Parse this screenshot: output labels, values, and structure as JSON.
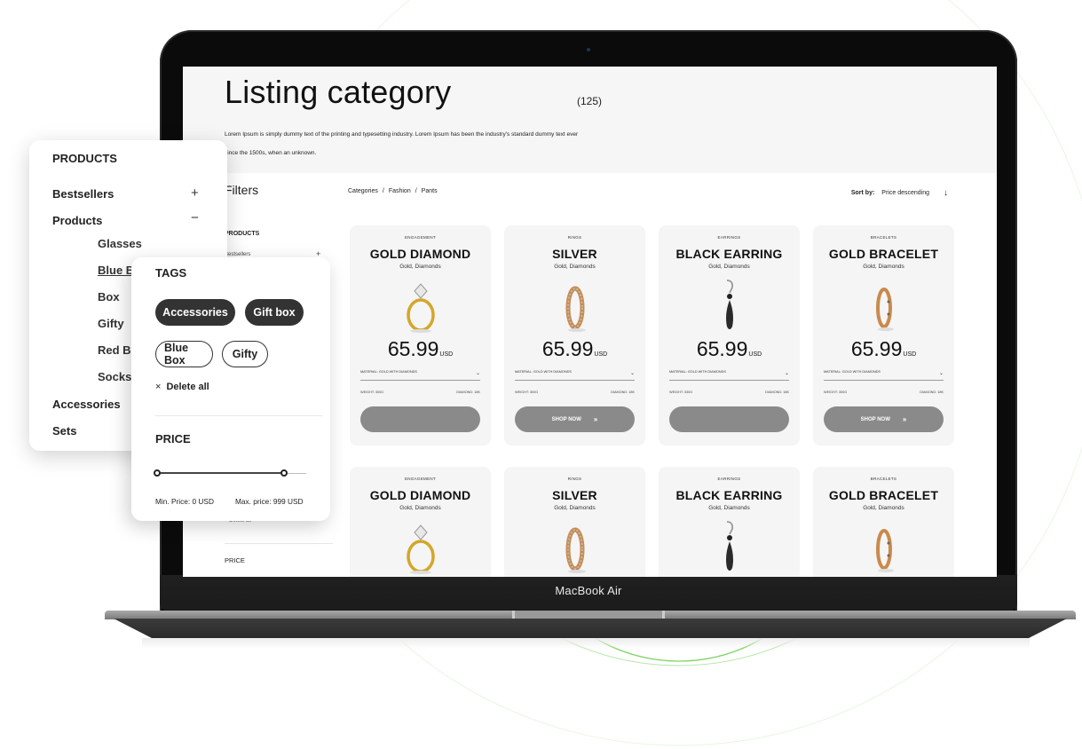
{
  "device": {
    "label": "MacBook Air"
  },
  "hero": {
    "title": "Listing category",
    "count": "(125)",
    "description": "Lorem Ipsum is simply dummy text of the printing and typesetting industry. Lorem Ipsum has been the industry's standard dummy text ever since the 1500s, when an unknown."
  },
  "filters": {
    "title": "Filters",
    "products_heading": "PRODUCTS",
    "bestsellers": "Bestsellers",
    "plus": "+",
    "delete_all": "× Delete all",
    "price_heading": "PRICE"
  },
  "breadcrumb": {
    "items": [
      "Categories",
      "Fashion",
      "Pants"
    ],
    "separator": "/"
  },
  "sort": {
    "label": "Sort by:",
    "value": "Price descending",
    "arrow": "↓"
  },
  "products": [
    {
      "category": "ENGAGEMENT",
      "name": "GOLD DIAMOND",
      "subtitle": "Gold, Diamonds",
      "price": "65.99",
      "currency": "USD",
      "material": "MATERIAL: GOLD WITH DIAMONDS",
      "weight": "WEIGHT: 300G",
      "diamond": "DIAMOND: 18K",
      "button": "",
      "image": "engagement-ring"
    },
    {
      "category": "RINGS",
      "name": "SILVER",
      "subtitle": "Gold, Diamonds",
      "price": "65.99",
      "currency": "USD",
      "material": "MATERIAL: GOLD WITH DIAMONDS",
      "weight": "WEIGHT: 300G",
      "diamond": "DIAMOND: 18K",
      "button": "SHOP NOW",
      "image": "eternity-ring"
    },
    {
      "category": "EARRINGS",
      "name": "BLACK EARRING",
      "subtitle": "Gold, Diamonds",
      "price": "65.99",
      "currency": "USD",
      "material": "MATERIAL: GOLD WITH DIAMONDS",
      "weight": "WEIGHT: 330G",
      "diamond": "DIAMOND: 18K",
      "button": "",
      "image": "drop-earring"
    },
    {
      "category": "BRACELETS",
      "name": "GOLD BRACELET",
      "subtitle": "Gold, Diamonds",
      "price": "65.99",
      "currency": "USD",
      "material": "MATERIAL: GOLD WITH DIAMONDS",
      "weight": "WEIGHT: 300G",
      "diamond": "DIAMOND: 18K",
      "button": "SHOP NOW",
      "image": "gold-band"
    },
    {
      "category": "ENGAGEMENT",
      "name": "GOLD DIAMOND",
      "subtitle": "Gold, Diamonds",
      "image": "engagement-ring"
    },
    {
      "category": "RINGS",
      "name": "SILVER",
      "subtitle": "Gold, Diamonds",
      "image": "eternity-ring"
    },
    {
      "category": "EARRINGS",
      "name": "BLACK EARRING",
      "subtitle": "Gold, Diamonds",
      "image": "drop-earring"
    },
    {
      "category": "BRACELETS",
      "name": "GOLD BRACELET",
      "subtitle": "Gold, Diamonds",
      "image": "gold-band"
    }
  ],
  "products_panel": {
    "title": "PRODUCTS",
    "items": [
      {
        "label": "Bestsellers",
        "sign": "+"
      },
      {
        "label": "Products",
        "sign": "−"
      }
    ],
    "sub_items": [
      "Glasses",
      "Blue Box",
      "Box",
      "Gifty",
      "Red Box",
      "Socks"
    ],
    "bottom_items": [
      "Accessories",
      "Sets"
    ]
  },
  "tags_panel": {
    "title": "TAGS",
    "active_tags": [
      "Accessories",
      "Gift box"
    ],
    "inactive_tags": [
      "Blue Box",
      "Gifty"
    ],
    "delete_all": "Delete all",
    "delete_icon": "×",
    "price_title": "PRICE",
    "min_label": "Min. Price: 0 USD",
    "max_label": "Max. price: 999 USD",
    "range_min_fraction": 0,
    "range_max_fraction": 0.85
  },
  "colors": {
    "accent_green": "#5cc83c",
    "button_gray": "#8a8a8a",
    "tag_dark": "#333333"
  }
}
